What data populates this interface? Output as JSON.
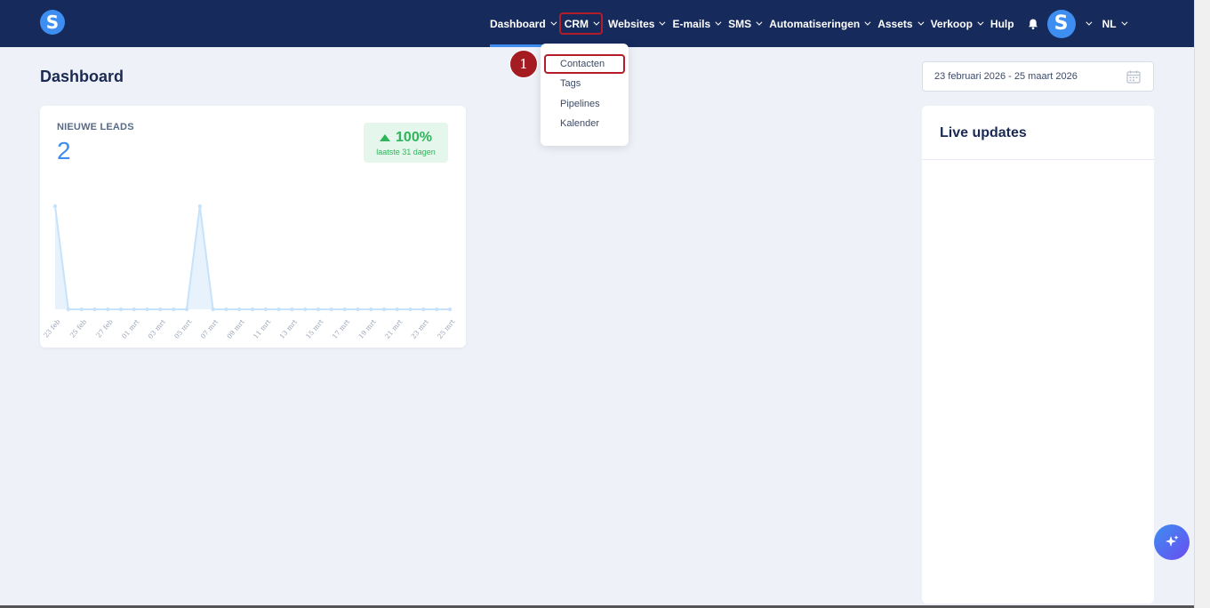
{
  "logo": {
    "letter": "S"
  },
  "nav": {
    "items": [
      {
        "label": "Dashboard"
      },
      {
        "label": "CRM"
      },
      {
        "label": "Websites"
      },
      {
        "label": "E-mails"
      },
      {
        "label": "SMS"
      },
      {
        "label": "Automatiseringen"
      },
      {
        "label": "Assets"
      },
      {
        "label": "Verkoop"
      },
      {
        "label": "Hulp"
      }
    ],
    "avatar_letter": "S",
    "language": "NL"
  },
  "crm_menu": {
    "items": [
      "Contacten",
      "Tags",
      "Pipelines",
      "Kalender"
    ]
  },
  "step_badge": "1",
  "page": {
    "title": "Dashboard",
    "date_range": "23 februari 2026 - 25 maart 2026"
  },
  "leads_card": {
    "label": "NIEUWE LEADS",
    "value": "2",
    "growth": "100%",
    "growth_period": "laatste 31 dagen"
  },
  "live_updates": {
    "title": "Live updates"
  },
  "colors": {
    "navbar": "#162a5c",
    "accent": "#3d8ef0",
    "highlight": "#b31d2a",
    "positive": "#2fb45a"
  },
  "chart_data": {
    "type": "area",
    "x": [
      "23 feb",
      "24 feb",
      "25 feb",
      "26 feb",
      "27 feb",
      "28 feb",
      "01 mrt",
      "02 mrt",
      "03 mrt",
      "04 mrt",
      "05 mrt",
      "06 mrt",
      "07 mrt",
      "08 mrt",
      "09 mrt",
      "10 mrt",
      "11 mrt",
      "12 mrt",
      "13 mrt",
      "14 mrt",
      "15 mrt",
      "16 mrt",
      "17 mrt",
      "18 mrt",
      "19 mrt",
      "20 mrt",
      "21 mrt",
      "22 mrt",
      "23 mrt",
      "24 mrt",
      "25 mrt"
    ],
    "values": [
      1,
      0,
      0,
      0,
      0,
      0,
      0,
      0,
      0,
      0,
      0,
      1,
      0,
      0,
      0,
      0,
      0,
      0,
      0,
      0,
      0,
      0,
      0,
      0,
      0,
      0,
      0,
      0,
      0,
      0,
      0
    ],
    "tick_labels": [
      "23 feb",
      "25 feb",
      "27 feb",
      "01 mrt",
      "03 mrt",
      "05 mrt",
      "07 mrt",
      "09 mrt",
      "11 mrt",
      "13 mrt",
      "15 mrt",
      "17 mrt",
      "19 mrt",
      "21 mrt",
      "23 mrt",
      "25 mrt"
    ],
    "ylim": [
      0,
      1
    ],
    "grid": false
  }
}
